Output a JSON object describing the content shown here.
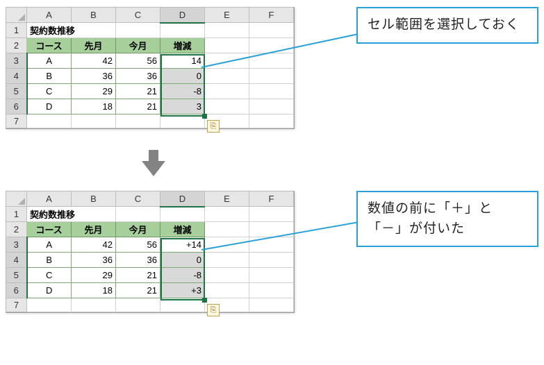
{
  "columns": [
    "A",
    "B",
    "C",
    "D",
    "E",
    "F"
  ],
  "rows_top": [
    "1",
    "2",
    "3",
    "4",
    "5",
    "6",
    "7"
  ],
  "rows_bot": [
    "1",
    "2",
    "3",
    "4",
    "5",
    "6",
    "7"
  ],
  "title": "契約数推移",
  "headers": {
    "course": "コース",
    "prev": "先月",
    "curr": "今月",
    "diff": "増減"
  },
  "data_top": [
    {
      "course": "A",
      "prev": "42",
      "curr": "56",
      "diff": "14"
    },
    {
      "course": "B",
      "prev": "36",
      "curr": "36",
      "diff": "0"
    },
    {
      "course": "C",
      "prev": "29",
      "curr": "21",
      "diff": "-8"
    },
    {
      "course": "D",
      "prev": "18",
      "curr": "21",
      "diff": "3"
    }
  ],
  "data_bot": [
    {
      "course": "A",
      "prev": "42",
      "curr": "56",
      "diff": "+14"
    },
    {
      "course": "B",
      "prev": "36",
      "curr": "36",
      "diff": "0"
    },
    {
      "course": "C",
      "prev": "29",
      "curr": "21",
      "diff": "-8"
    },
    {
      "course": "D",
      "prev": "18",
      "curr": "21",
      "diff": "+3"
    }
  ],
  "callout_top": "セル範囲を選択しておく",
  "callout_bot": "数値の前に「＋」と「－」が付いた",
  "qa_icon": "⎘",
  "colors": {
    "accent": "#2aa0d8",
    "sel": "#1f7246",
    "ghead": "#a7cf9c"
  }
}
